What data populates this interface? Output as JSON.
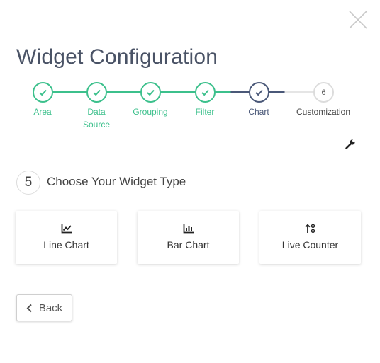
{
  "dialog": {
    "title": "Widget Configuration"
  },
  "stepper": {
    "steps": [
      {
        "label": "Area",
        "state": "done"
      },
      {
        "label": "Data Source",
        "state": "done"
      },
      {
        "label": "Grouping",
        "state": "done"
      },
      {
        "label": "Filter",
        "state": "done"
      },
      {
        "label": "Chart",
        "state": "current"
      },
      {
        "label": "Customization",
        "state": "pending",
        "number": "6"
      }
    ]
  },
  "section": {
    "number": "5",
    "title": "Choose Your Widget Type"
  },
  "widget_types": [
    {
      "label": "Line Chart",
      "icon": "line-chart-icon"
    },
    {
      "label": "Bar Chart",
      "icon": "bar-chart-icon"
    },
    {
      "label": "Live Counter",
      "icon": "live-counter-icon"
    }
  ],
  "footer": {
    "back_label": "Back"
  },
  "colors": {
    "done": "#3cc08c",
    "current": "#4a5878",
    "pending": "#dcdcdc",
    "title": "#4a5366"
  }
}
